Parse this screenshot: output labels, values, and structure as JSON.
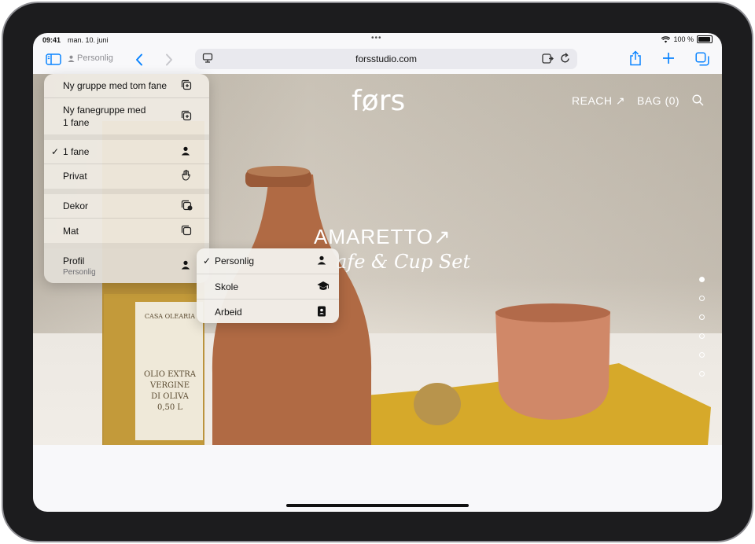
{
  "status": {
    "time": "09:41",
    "date": "man. 10. juni",
    "battery": "100 %"
  },
  "toolbar": {
    "profile_label": "Personlig",
    "url": "forsstudio.com"
  },
  "site": {
    "logo": "førs",
    "nav": {
      "reach": "REACH ↗",
      "bag": "BAG (0)"
    },
    "headline": "AMARETTO↗",
    "subline": "afe & Cup Set",
    "bottle_label_1": "CASA OLEARIA",
    "bottle_label_2": "OLIO EXTRA",
    "bottle_label_3": "VERGINE",
    "bottle_label_4": "DI OLIVA",
    "bottle_label_5": "0,50 L",
    "pager_active_index": 0
  },
  "menu": {
    "items": [
      {
        "label": "Ny gruppe med tom fane",
        "icon": "new-tab-group-icon"
      },
      {
        "label": "Ny fanegruppe med",
        "label2": "1 fane",
        "icon": "new-tab-group-from-tab-icon"
      },
      {
        "label": "1 fane",
        "icon": "person-icon",
        "checked": true
      },
      {
        "label": "Privat",
        "icon": "hand-raised-icon"
      },
      {
        "label": "Dekor",
        "icon": "tab-group-icon"
      },
      {
        "label": "Mat",
        "icon": "tab-group-icon"
      },
      {
        "label": "Profil",
        "sublabel": "Personlig",
        "icon": "person-icon"
      }
    ],
    "checkmark": "✓"
  },
  "submenu": {
    "items": [
      {
        "label": "Personlig",
        "icon": "person-icon",
        "checked": true
      },
      {
        "label": "Skole",
        "icon": "graduation-cap-icon"
      },
      {
        "label": "Arbeid",
        "icon": "id-badge-icon"
      }
    ]
  },
  "colors": {
    "accent": "#0a84ff",
    "bezel": "#1c1c1e",
    "menu_bg": "#f0ece4"
  }
}
